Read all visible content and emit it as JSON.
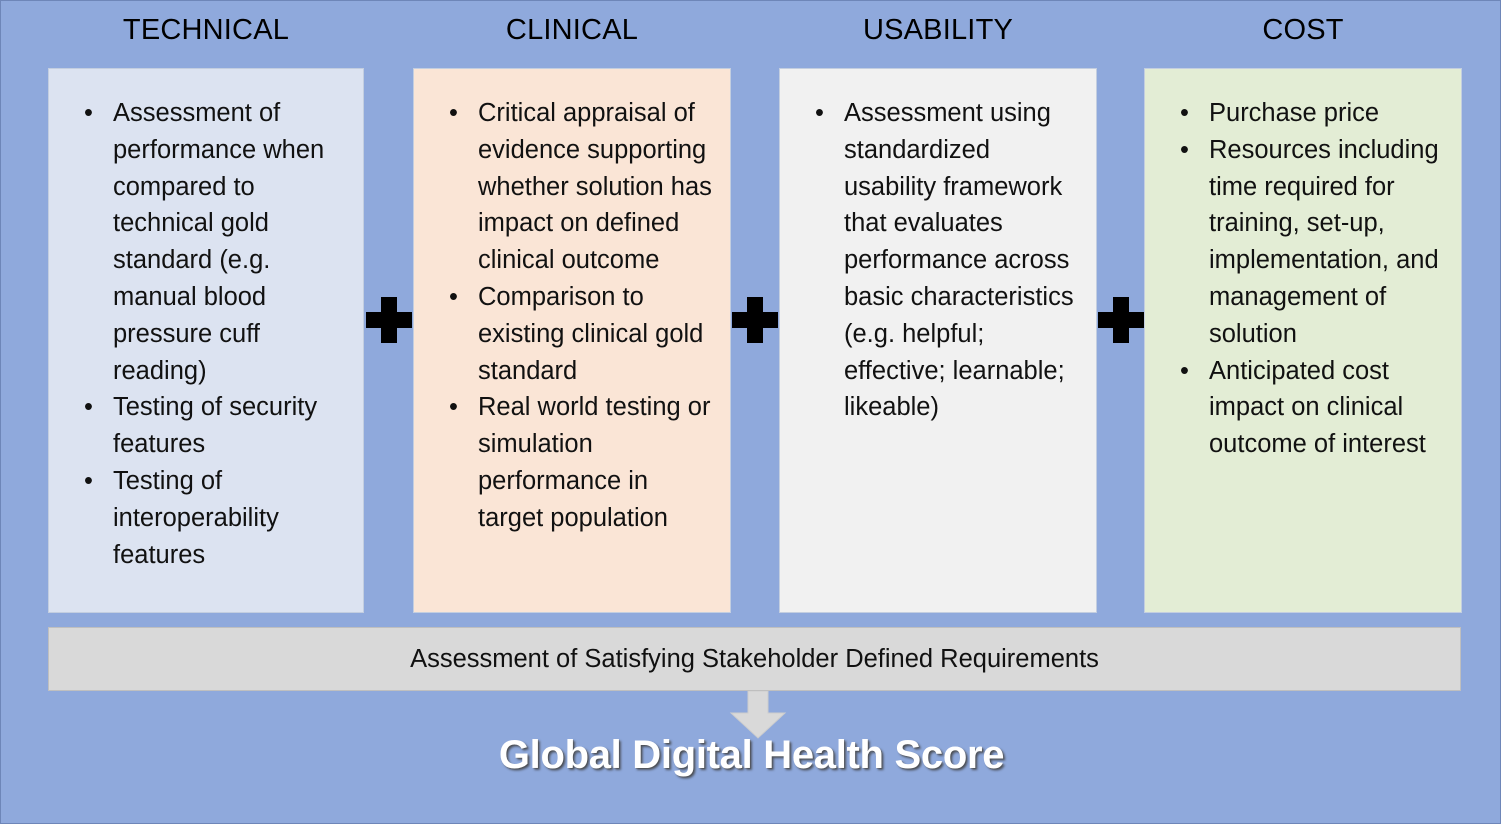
{
  "columns": [
    {
      "header": "TECHNICAL",
      "color": "#DCE3F1",
      "bullets": [
        "Assessment of performance when compared to technical gold standard (e.g. manual blood pressure cuff reading)",
        "Testing of security features",
        "Testing of interoperability features"
      ]
    },
    {
      "header": "CLINICAL",
      "color": "#FAE5D6",
      "bullets": [
        "Critical appraisal of evidence supporting whether solution has impact on defined clinical outcome",
        "Comparison to existing clinical gold standard",
        "Real world testing or simulation performance in target population"
      ]
    },
    {
      "header": "USABILITY",
      "color": "#F1F1F1",
      "bullets": [
        "Assessment using standardized usability framework that evaluates performance across basic characteristics (e.g. helpful; effective; learnable; likeable)"
      ]
    },
    {
      "header": "COST",
      "color": "#E3EDD5",
      "bullets": [
        "Purchase price",
        "Resources including time required for training, set-up, implementation, and management of solution",
        "Anticipated cost impact on clinical outcome of interest"
      ]
    }
  ],
  "operators": [
    "+",
    "+",
    "+"
  ],
  "requirements_bar": {
    "label": "Assessment of Satisfying Stakeholder Defined Requirements",
    "color": "#D9D9D9"
  },
  "arrow": {
    "name": "down-arrow-icon",
    "color": "#D9D9D9"
  },
  "score": {
    "title": "Global Digital Health Score",
    "color": "#FFFFFF"
  },
  "background": {
    "color": "#8FA9DC"
  },
  "bullet_glyph": "•"
}
